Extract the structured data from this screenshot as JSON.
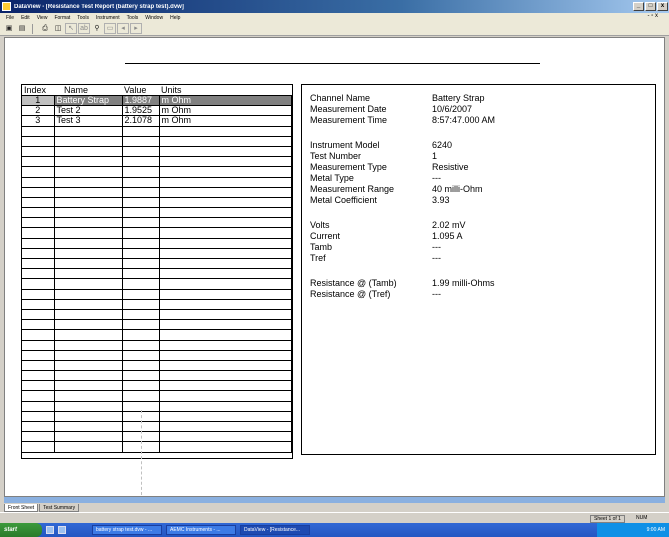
{
  "window": {
    "title": "DataView - [Resistance Test Report (battery strap test).dvw]"
  },
  "menu": {
    "items": [
      "File",
      "Edit",
      "View",
      "Format",
      "Tools",
      "Instrument",
      "Tools",
      "Window",
      "Help"
    ],
    "mdi_controls": "- ▫ x"
  },
  "toolbar": {
    "icons": [
      "new-icon",
      "save-icon",
      "print-icon",
      "preview-icon",
      "pointer-icon",
      "text-icon",
      "zoom-icon",
      "page-icon",
      "prev-icon",
      "next-icon"
    ]
  },
  "table": {
    "columns": [
      "Index",
      "Name",
      "Value",
      "Units"
    ],
    "rows": [
      {
        "index": "1",
        "name": "Battery Strap",
        "value": "1.9887",
        "units": "m Ohm",
        "selected": true
      },
      {
        "index": "2",
        "name": "Test 2",
        "value": "1.9525",
        "units": "m Ohm",
        "selected": false
      },
      {
        "index": "3",
        "name": "Test 3",
        "value": "2.1078",
        "units": "m Ohm",
        "selected": false
      }
    ],
    "empty_rows": 32
  },
  "details": {
    "groups": [
      [
        {
          "label": "Channel Name",
          "value": "Battery Strap"
        },
        {
          "label": "Measurement Date",
          "value": "10/6/2007"
        },
        {
          "label": "Measurement Time",
          "value": "8:57:47.000 AM"
        }
      ],
      [
        {
          "label": "Instrument Model",
          "value": "6240"
        },
        {
          "label": "Test Number",
          "value": "1"
        },
        {
          "label": "Measurement Type",
          "value": "Resistive"
        },
        {
          "label": "Metal Type",
          "value": "---"
        },
        {
          "label": "Measurement Range",
          "value": "40 milli-Ohm"
        },
        {
          "label": "Metal Coefficient",
          "value": "3.93"
        }
      ],
      [
        {
          "label": "Volts",
          "value": "2.02 mV"
        },
        {
          "label": "Current",
          "value": "1.095 A"
        },
        {
          "label": "Tamb",
          "value": "---"
        },
        {
          "label": "Tref",
          "value": "---"
        }
      ],
      [
        {
          "label": "Resistance @ (Tamb)",
          "value": "1.99 milli-Ohms"
        },
        {
          "label": "Resistance @ (Tref)",
          "value": "---"
        }
      ]
    ]
  },
  "tabs": [
    "Front Sheet",
    "Test Summary"
  ],
  "status": {
    "sheet": "Sheet 1 of 1",
    "mode": "NUM"
  },
  "taskbar": {
    "start": "start",
    "tasks": [
      "battery strap test.dvw - ...",
      "AEMC Instruments - ...",
      "DataView - [Resistance..."
    ],
    "clock": "9:00 AM"
  },
  "colors": {
    "selection": "#808080",
    "titlebar": "#0a246a",
    "taskbar": "#3168d5",
    "start": "#3c9a3c"
  }
}
